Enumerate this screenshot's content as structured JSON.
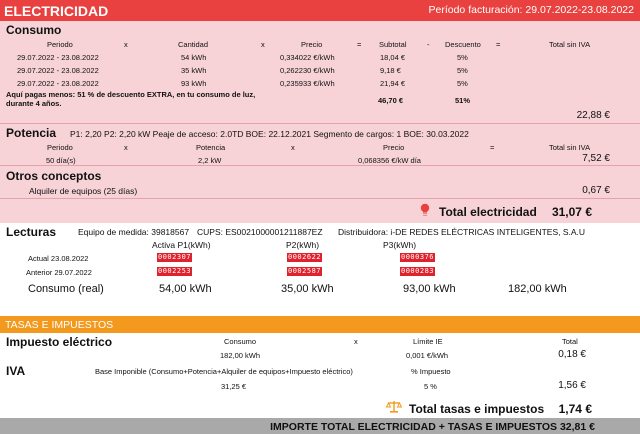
{
  "header": {
    "title": "ELECTRICIDAD",
    "periodo": "Período facturación: 29.07.2022-23.08.2022"
  },
  "consumo": {
    "title": "Consumo",
    "columns": [
      "Periodo",
      "x",
      "Cantidad",
      "x",
      "Precio",
      "=",
      "Subtotal",
      "-",
      "Descuento",
      "=",
      "Total sin IVA"
    ],
    "rows": [
      {
        "periodo": "29.07.2022 - 23.08.2022",
        "cantidad": "54 kWh",
        "precio": "0,334022 €/kWh",
        "subtotal": "18,04 €",
        "descuento": "5%"
      },
      {
        "periodo": "29.07.2022 - 23.08.2022",
        "cantidad": "35 kWh",
        "precio": "0,262230 €/kWh",
        "subtotal": "9,18 €",
        "descuento": "5%"
      },
      {
        "periodo": "29.07.2022 - 23.08.2022",
        "cantidad": "93 kWh",
        "precio": "0,235933 €/kWh",
        "subtotal": "21,94 €",
        "descuento": "5%"
      }
    ],
    "note_line1": "Aquí pagas menos: 51 % de descuento EXTRA, en tu consumo de luz,",
    "note_line2": "durante 4 años.",
    "sum_subtotal": "46,70 €",
    "sum_descuento": "51%",
    "total": "22,88 €"
  },
  "potencia": {
    "title": "Potencia",
    "info": "P1: 2,20 P2: 2,20 kW  Peaje de acceso: 2.0TD  BOE: 22.12.2021  Segmento de cargos: 1  BOE: 30.03.2022",
    "columns": [
      "Periodo",
      "x",
      "Potencia",
      "x",
      "Precio",
      "=",
      "Total sin IVA"
    ],
    "row": {
      "periodo": "50 día(s)",
      "potencia": "2,2 kW",
      "precio": "0,068356 €/kW día",
      "total": "7,52 €"
    }
  },
  "otros": {
    "title": "Otros conceptos",
    "item": "Alquiler de equipos (25 días)",
    "value": "0,67 €"
  },
  "total_electricidad": {
    "label": "Total electricidad",
    "value": "31,07 €"
  },
  "lecturas": {
    "title": "Lecturas",
    "equipo": "Equipo de medida: 39818567",
    "cups": "CUPS: ES0021000001211887EZ",
    "distribuidora": "Distribuidora: i-DE REDES ELÉCTRICAS INTELIGENTES, S.A.U",
    "col_p1": "Activa P1(kWh)",
    "col_p2": "P2(kWh)",
    "col_p3": "P3(kWh)",
    "actual_label": "Actual 23.08.2022",
    "anterior_label": "Anterior 29.07.2022",
    "actual": [
      "0002307",
      "0002622",
      "0000376"
    ],
    "anterior": [
      "0002253",
      "0002587",
      "0000283"
    ],
    "consumo_label": "Consumo (real)",
    "consumo": [
      "54,00 kWh",
      "35,00 kWh",
      "93,00 kWh",
      "182,00 kWh"
    ]
  },
  "tasas": {
    "title": "TASAS E IMPUESTOS",
    "ie_title": "Impuesto eléctrico",
    "ie_cols": [
      "Consumo",
      "x",
      "Límite IE",
      "Total"
    ],
    "ie_consumo": "182,00 kWh",
    "ie_limite": "0,001 €/kWh",
    "ie_total": "0,18 €",
    "iva_title": "IVA",
    "iva_base_label": "Base Imponible (Consumo+Potencia+Alquiler de equipos+Impuesto eléctrico)",
    "iva_pct_label": "% Impuesto",
    "iva_base": "31,25 €",
    "iva_pct": "5 %",
    "iva_total": "1,56 €",
    "total_label": "Total tasas e impuestos",
    "total_value": "1,74 €"
  },
  "footer": {
    "label": "IMPORTE TOTAL ELECTRICIDAD + TASAS E IMPUESTOS 32,81 €"
  },
  "colors": {
    "red": "#e8413f",
    "pink": "#f7d3d7",
    "orange": "#f39a1e",
    "grey": "#a9a9a9"
  }
}
